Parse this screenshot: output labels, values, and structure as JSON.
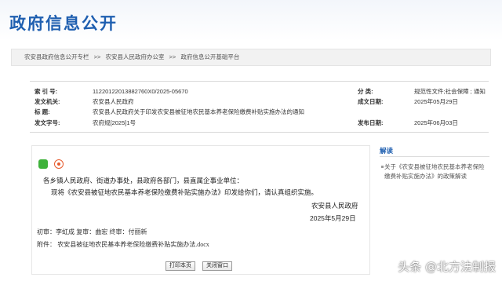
{
  "header": {
    "site_title": "政府信息公开"
  },
  "breadcrumb": {
    "items": [
      "农安县政府信息公开专栏",
      ">>",
      "农安县人民政府办公室",
      ">>",
      "政府信息公开基础平台"
    ]
  },
  "meta": {
    "index_key": "索 引 号:",
    "index_val": "11220122013882760X0/2025-05670",
    "category_key": "分 类:",
    "category_val": "规范性文件;社会保障 ; 通知",
    "issuer_key": "发文机关:",
    "issuer_val": "农安县人民政府",
    "created_key": "成文日期:",
    "created_val": "2025年05月29日",
    "title_key": "标 题:",
    "title_val": "农安县人民政府关于印发农安县被征地农民基本养老保险缴费补贴实施办法的通知",
    "docno_key": "发文字号:",
    "docno_val": "农府规[2025]1号",
    "published_key": "发布日期:",
    "published_val": "2025年06月03日"
  },
  "content": {
    "salutation": "各乡镇人民政府、街道办事处，县政府各部门，县直属企事业单位：",
    "body": "现将《农安县被征地农民基本养老保险缴费补贴实施办法》印发给你们，请认真组织实施。",
    "signature_org": "农安县人民政府",
    "signature_date": "2025年5月29日",
    "review_line": "初审：李虹成  复审：曲宏  终审：付丽新",
    "attachment_label": "附件：",
    "attachment_file": "农安县被征地农民基本养老保险缴费补贴实施办法.docx"
  },
  "buttons": {
    "print": "打印本页",
    "close": "关闭窗口"
  },
  "sidebar": {
    "title": "解读",
    "item": "关于《农安县被征地农民基本养老保险缴费补贴实施办法》的政策解读"
  },
  "watermark": "头条 @北方法制报",
  "icons": {
    "share_1": "wechat-icon",
    "share_2": "weibo-icon"
  },
  "colors": {
    "brand": "#1f5fb0",
    "wechat": "#3fb23b",
    "weibo": "#e65b2e"
  }
}
